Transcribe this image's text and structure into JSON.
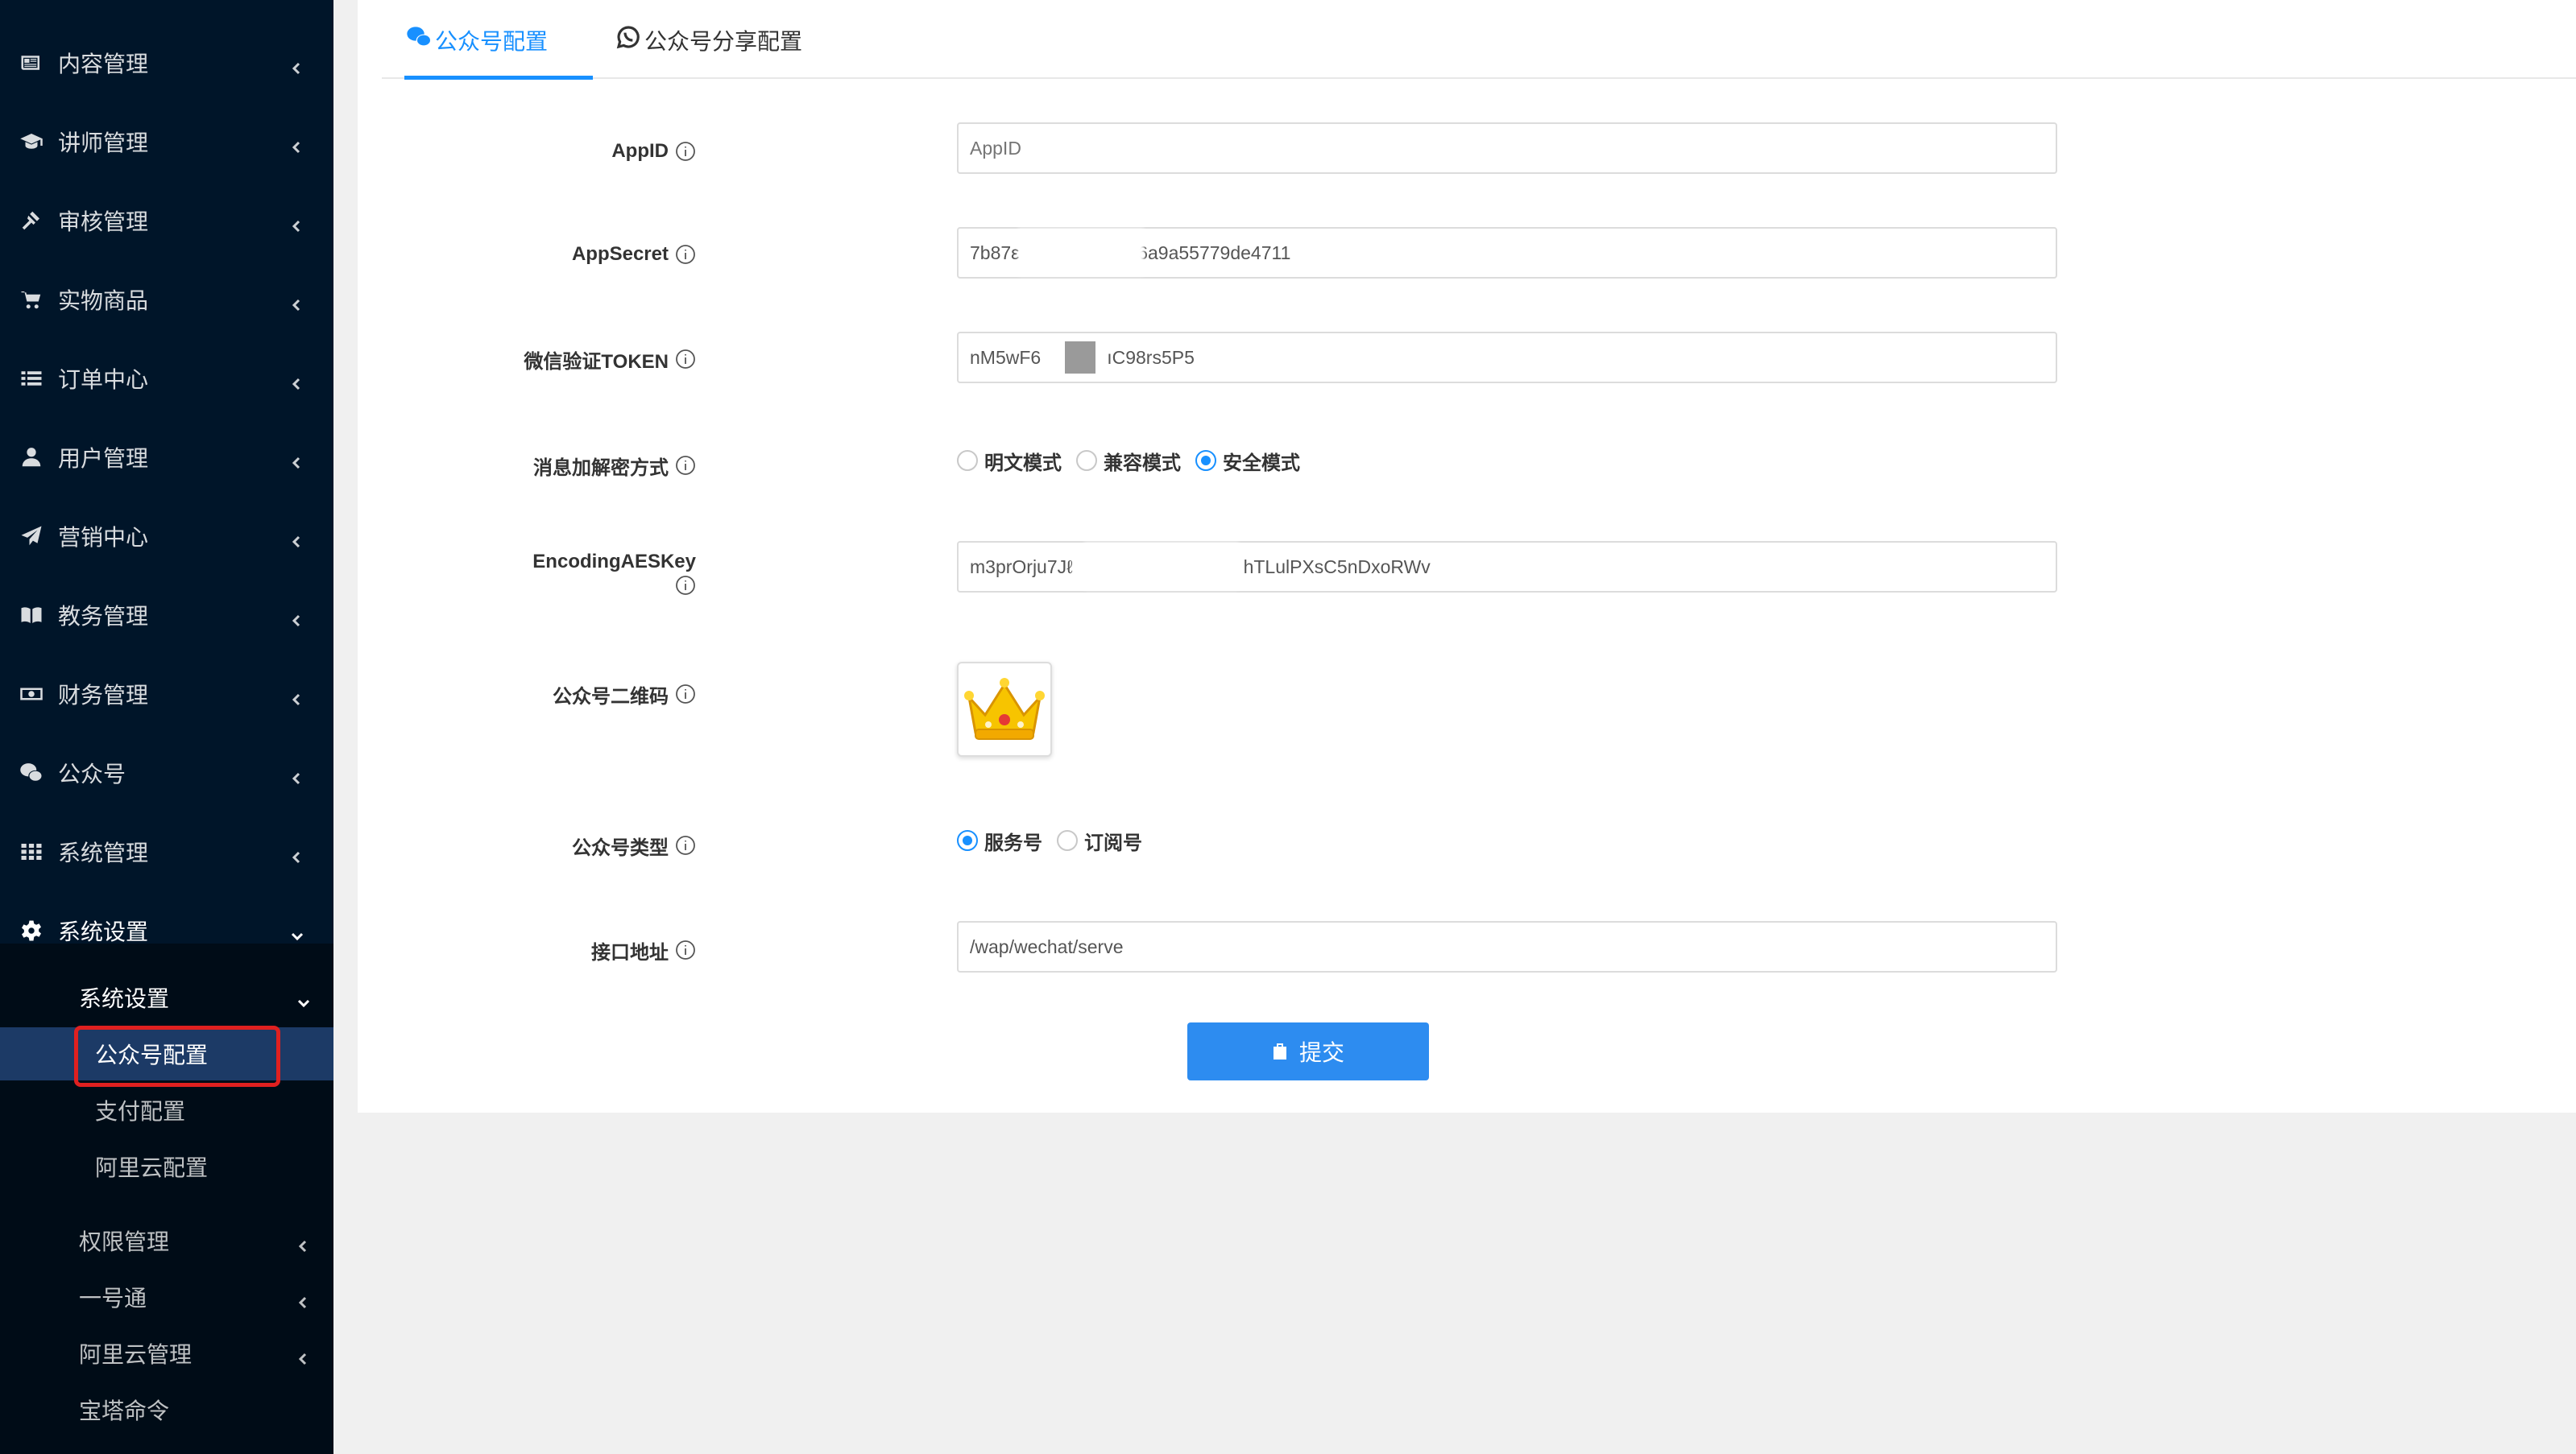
{
  "sidebar": {
    "items": [
      {
        "label": "内容管理",
        "icon": "newspaper-icon"
      },
      {
        "label": "讲师管理",
        "icon": "graduation-cap-icon"
      },
      {
        "label": "审核管理",
        "icon": "gavel-icon"
      },
      {
        "label": "实物商品",
        "icon": "cart-icon"
      },
      {
        "label": "订单中心",
        "icon": "list-icon"
      },
      {
        "label": "用户管理",
        "icon": "user-icon"
      },
      {
        "label": "营销中心",
        "icon": "paper-plane-icon"
      },
      {
        "label": "教务管理",
        "icon": "book-icon"
      },
      {
        "label": "财务管理",
        "icon": "money-icon"
      },
      {
        "label": "公众号",
        "icon": "wechat-icon"
      },
      {
        "label": "系统管理",
        "icon": "grid-icon"
      },
      {
        "label": "系统设置",
        "icon": "gear-icon"
      }
    ],
    "submenu": {
      "group_label": "系统设置",
      "children": [
        "公众号配置",
        "支付配置",
        "阿里云配置"
      ],
      "others": [
        "权限管理",
        "一号通",
        "阿里云管理",
        "宝塔命令"
      ]
    }
  },
  "tabs": [
    {
      "label": "公众号配置",
      "icon": "wechat-icon",
      "active": true
    },
    {
      "label": "公众号分享配置",
      "icon": "whatsapp-icon",
      "active": false
    }
  ],
  "form": {
    "appid": {
      "label": "AppID",
      "value": "",
      "placeholder": "AppID"
    },
    "appsecret": {
      "label": "AppSecret",
      "value_start": "7b87ε",
      "value_end": "36a9a55779de4711"
    },
    "token": {
      "label": "微信验证TOKEN",
      "value_start": "nM5wF6",
      "value_end": "ıC98rs5P5"
    },
    "encrypt_mode": {
      "label": "消息加解密方式",
      "options": [
        "明文模式",
        "兼容模式",
        "安全模式"
      ],
      "selected": "安全模式"
    },
    "aeskey": {
      "label": "EncodingAESKey",
      "value_start": "m3prOrju7Jℓ",
      "value_end": "hTLulPXsC5nDxoRWv"
    },
    "qrcode": {
      "label": "公众号二维码",
      "image": "crown-icon"
    },
    "account_type": {
      "label": "公众号类型",
      "options": [
        "服务号",
        "订阅号"
      ],
      "selected": "服务号"
    },
    "endpoint": {
      "label": "接口地址",
      "value": "/wap/wechat/serve"
    },
    "submit_label": "提交"
  },
  "colors": {
    "sidebar_bg": "#001529",
    "submenu_bg": "#000c17",
    "active_item_bg": "#1c3a66",
    "primary": "#1890ff",
    "button": "#2d8cf0",
    "highlight_border": "#e02020"
  }
}
